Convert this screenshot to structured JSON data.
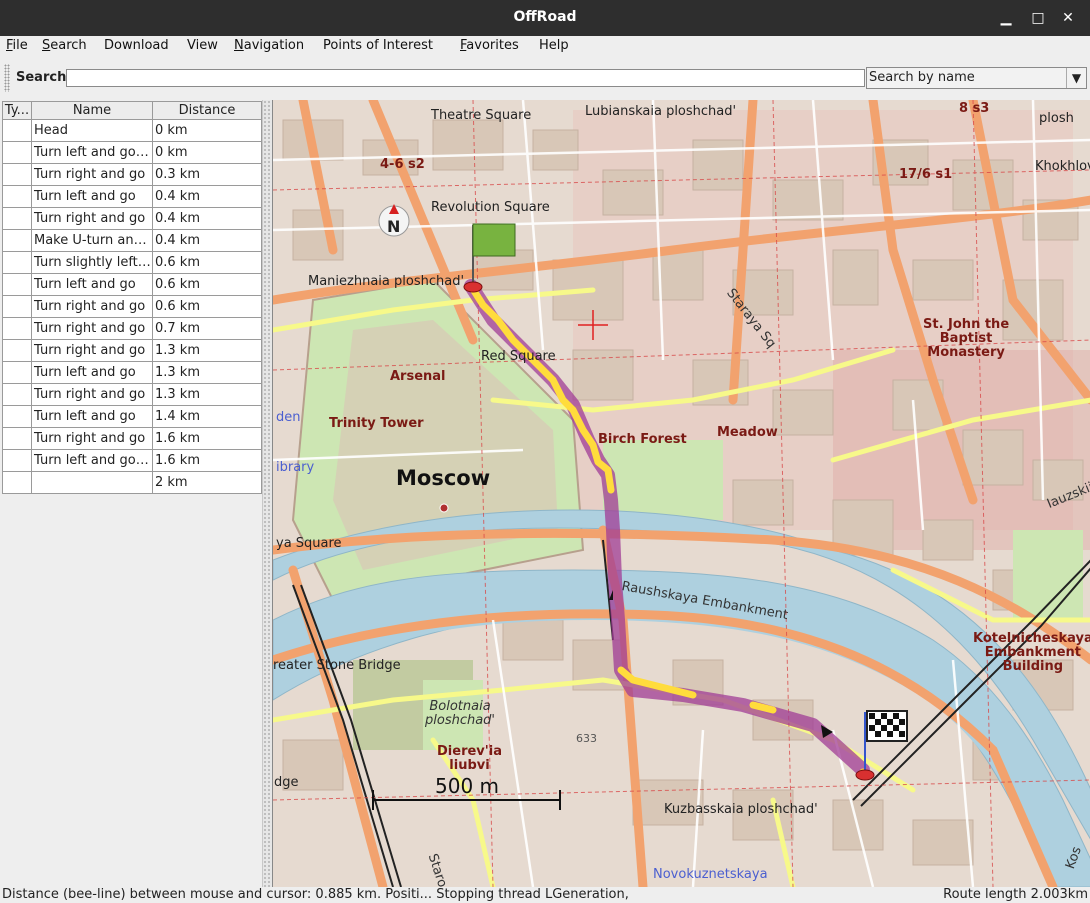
{
  "window": {
    "title": "OffRoad"
  },
  "menu": [
    {
      "label": "File",
      "mnemonic": "F",
      "rest": "ile"
    },
    {
      "label": "Search",
      "mnemonic": "S",
      "rest": "earch"
    },
    {
      "label": "Download",
      "mnemonic": "",
      "rest": "Download"
    },
    {
      "label": "View",
      "mnemonic": "",
      "rest": "View"
    },
    {
      "label": "Navigation",
      "mnemonic": "N",
      "rest": "avigation"
    },
    {
      "label": "Points of Interest",
      "mnemonic": "",
      "rest": "Points of Interest"
    },
    {
      "label": "Favorites",
      "mnemonic": "F",
      "rest": "avorites"
    },
    {
      "label": "Help",
      "mnemonic": "",
      "rest": "Help"
    }
  ],
  "search": {
    "label": "Search",
    "value": "",
    "mode": "Search by name"
  },
  "route_table": {
    "columns": [
      "Ty...",
      "Name",
      "Distance"
    ],
    "rows": [
      {
        "type": "",
        "name": "Head",
        "distance": "0 km"
      },
      {
        "type": "",
        "name": "Turn left and go ...",
        "distance": "0 km"
      },
      {
        "type": "",
        "name": "Turn right and go",
        "distance": "0.3 km"
      },
      {
        "type": "",
        "name": "Turn left and go",
        "distance": "0.4 km"
      },
      {
        "type": "",
        "name": "Turn right and go",
        "distance": "0.4 km"
      },
      {
        "type": "",
        "name": "Make U-turn and...",
        "distance": "0.4 km"
      },
      {
        "type": "",
        "name": "Turn slightly left ...",
        "distance": "0.6 km"
      },
      {
        "type": "",
        "name": "Turn left and go",
        "distance": "0.6 km"
      },
      {
        "type": "",
        "name": "Turn right and go",
        "distance": "0.6 km"
      },
      {
        "type": "",
        "name": "Turn right and go",
        "distance": "0.7 km"
      },
      {
        "type": "",
        "name": "Turn right and go",
        "distance": "1.3 km"
      },
      {
        "type": "",
        "name": "Turn left and go",
        "distance": "1.3 km"
      },
      {
        "type": "",
        "name": "Turn right and go",
        "distance": "1.3 km"
      },
      {
        "type": "",
        "name": "Turn left and go",
        "distance": "1.4 km"
      },
      {
        "type": "",
        "name": "Turn right and go",
        "distance": "1.6 km"
      },
      {
        "type": "",
        "name": "Turn left and go ...",
        "distance": "1.6 km"
      },
      {
        "type": "",
        "name": "",
        "distance": "2 km"
      }
    ]
  },
  "map": {
    "compass": "N",
    "scale": "500 m",
    "labels": {
      "theatre_square": "Theatre Square",
      "lubianskaia": "Lubianskaia ploshchad'",
      "s8s3": "8 s3",
      "plosh": "plosh",
      "khokhlo": "Khokhlov",
      "s46s2": "4-6 s2",
      "s17_6s1": "17/6 s1",
      "revolution": "Revolution Square",
      "maniezh": "Maniezhnaia ploshchad'",
      "stariaya": "Staraya Sq",
      "stjohn": "St. John the\nBaptist\nMonastery",
      "red_square": "Red Square",
      "arsenal": "Arsenal",
      "den": "den",
      "trinity": "Trinity Tower",
      "birch": "Birch Forest",
      "meadow": "Meadow",
      "library": "ibrary",
      "moscow": "Moscow",
      "iauzskii": "Iauzskii",
      "ya_square": "ya Square",
      "raushskaya": "Raushskaya Embankment",
      "greater_stone": "reater Stone Bridge",
      "kotelnich": "Kotelnicheskaya\nEmbankment\nBuilding",
      "bolotnaia": "Bolotnaia\nploshchad'",
      "dierev": "Dierev'ia\nliubvi",
      "n633": "633",
      "dge": "dge",
      "kuzbass": "Kuzbasskaia ploshchad'",
      "staro": "Staro",
      "novokuz": "Novokuznetskaya",
      "kos": "Kos"
    }
  },
  "status": {
    "left": "Distance (bee-line) between mouse and cursor: 0.885 km. Positi... Stopping thread LGeneration,",
    "right": "Route length 2.003km"
  },
  "colors": {
    "map_bg": "#e9e1d6",
    "building": "#d8c7b7",
    "pink_area": "#e7b9b4",
    "river": "#aed0df",
    "park": "#cde6b3",
    "major_road": "#f2a26e",
    "secondary_road": "#f7f98a",
    "route_yellow": "#ffdc3c",
    "route_purple": "#a03c96"
  }
}
